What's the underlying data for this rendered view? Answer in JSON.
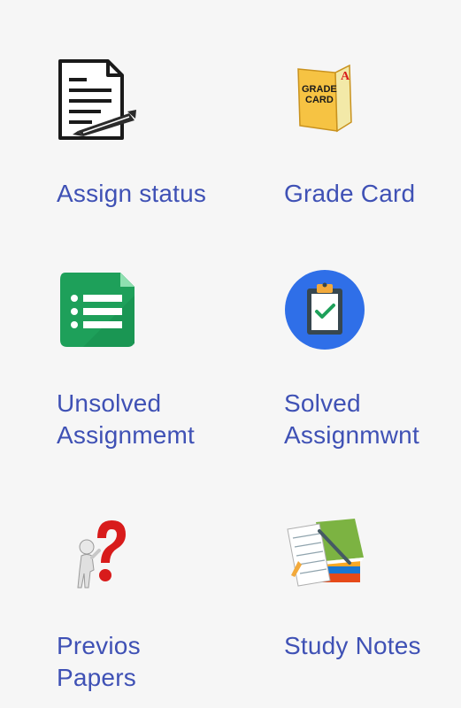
{
  "menu": {
    "items": [
      {
        "label": "Assign status",
        "icon": "document-pen-icon"
      },
      {
        "label": "Grade Card",
        "icon": "grade-card-icon",
        "icon_text": "GRADE CARD"
      },
      {
        "label": "Unsolved\nAssignmemt",
        "icon": "list-sheet-icon"
      },
      {
        "label": "Solved\nAssignmwnt",
        "icon": "clipboard-check-icon"
      },
      {
        "label": "Previos\nPapers",
        "icon": "question-figure-icon"
      },
      {
        "label": "Study Notes",
        "icon": "books-notes-icon"
      }
    ]
  },
  "colors": {
    "label": "#3f51b5",
    "background": "#f6f6f6",
    "sheet_green": "#1ea05a",
    "clipboard_blue": "#2f6fe8",
    "grade_card_yellow": "#f6c343",
    "question_red": "#d81b1b"
  }
}
